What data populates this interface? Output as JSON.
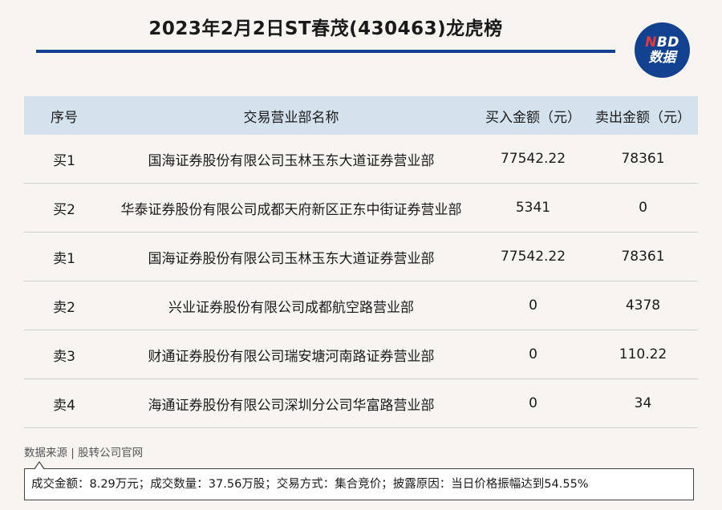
{
  "header": {
    "title": "2023年2月2日ST春茂(430463)龙虎榜",
    "logo_top": "NBD",
    "logo_top_accent": "N",
    "logo_top_rest": "BD",
    "logo_bottom": "数据"
  },
  "table": {
    "columns": [
      "序号",
      "交易营业部名称",
      "买入金额（元）",
      "卖出金额（元）"
    ],
    "rows": [
      {
        "seq": "买1",
        "name": "国海证券股份有限公司玉林玉东大道证券营业部",
        "buy": "77542.22",
        "sell": "78361"
      },
      {
        "seq": "买2",
        "name": "华泰证券股份有限公司成都天府新区正东中街证券营业部",
        "buy": "5341",
        "sell": "0"
      },
      {
        "seq": "卖1",
        "name": "国海证券股份有限公司玉林玉东大道证券营业部",
        "buy": "77542.22",
        "sell": "78361"
      },
      {
        "seq": "卖2",
        "name": "兴业证券股份有限公司成都航空路营业部",
        "buy": "0",
        "sell": "4378"
      },
      {
        "seq": "卖3",
        "name": "财通证券股份有限公司瑞安塘河南路证券营业部",
        "buy": "0",
        "sell": "110.22"
      },
      {
        "seq": "卖4",
        "name": "海通证券股份有限公司深圳分公司华富路营业部",
        "buy": "0",
        "sell": "34"
      }
    ]
  },
  "footer": {
    "source": "数据来源 | 股转公司官网",
    "note": "成交金额：8.29万元；成交数量：37.56万股；交易方式：集合竞价；披露原因：当日价格振幅达到54.55%"
  },
  "colors": {
    "brand_blue": "#12418f",
    "header_bg": "#d4e2ee",
    "accent_red": "#e63a3a",
    "page_bg": "#f8f5f0"
  }
}
